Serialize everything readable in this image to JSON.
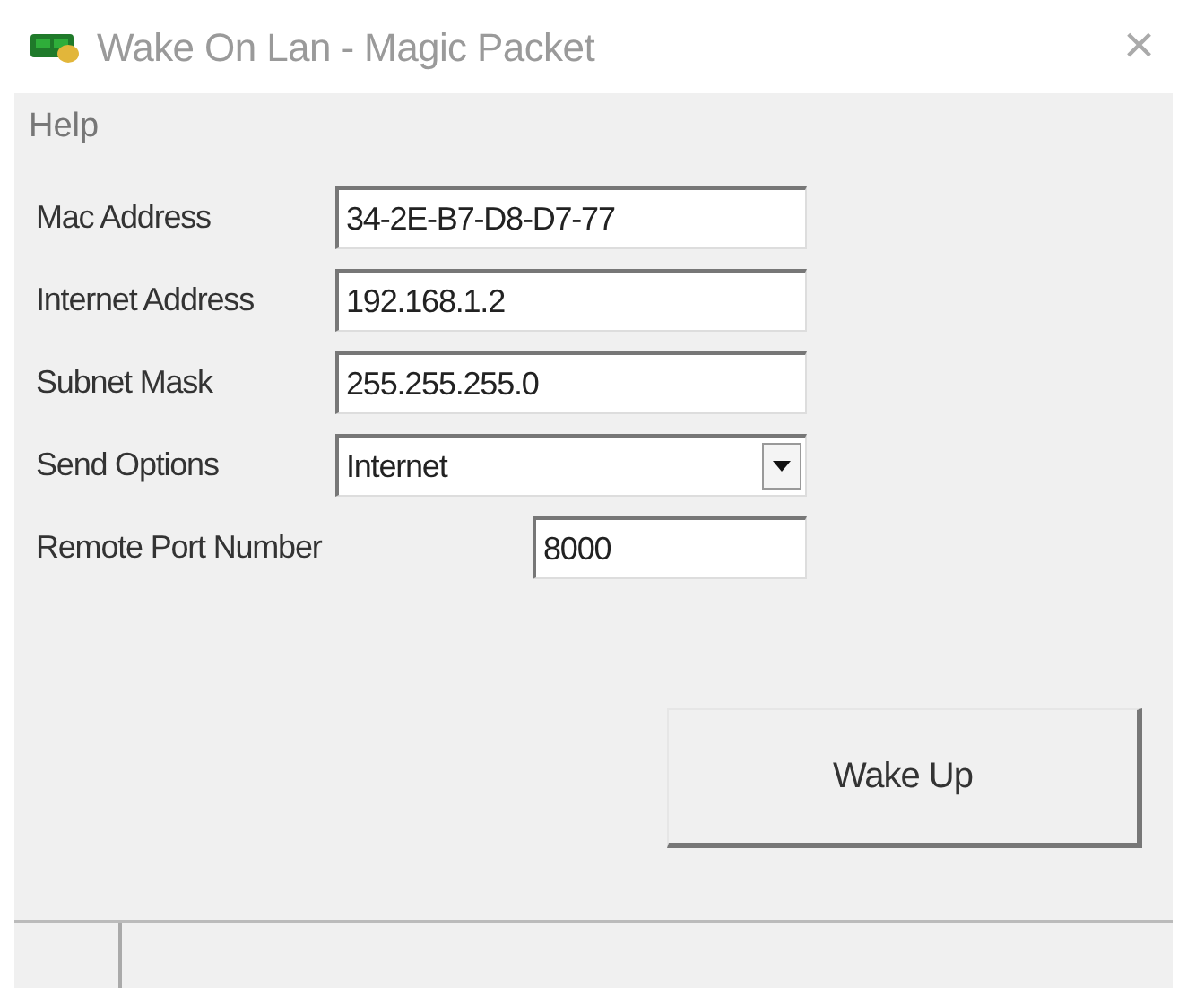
{
  "window": {
    "title": "Wake On Lan - Magic Packet",
    "close": "×"
  },
  "menu": [
    {
      "label": "Help"
    }
  ],
  "fields": [
    {
      "kind": "text",
      "label": "Mac Address",
      "value": "34-2E-B7-D8-D7-77"
    },
    {
      "kind": "text",
      "label": "Internet Address",
      "value": "192.168.1.2"
    },
    {
      "kind": "text",
      "label": "Subnet Mask",
      "value": "255.255.255.0"
    },
    {
      "kind": "select",
      "label": "Send Options",
      "value": "Internet"
    },
    {
      "kind": "short",
      "label": "Remote Port Number",
      "value": "8000"
    }
  ],
  "buttons": [
    {
      "label": "Wake Up"
    }
  ]
}
